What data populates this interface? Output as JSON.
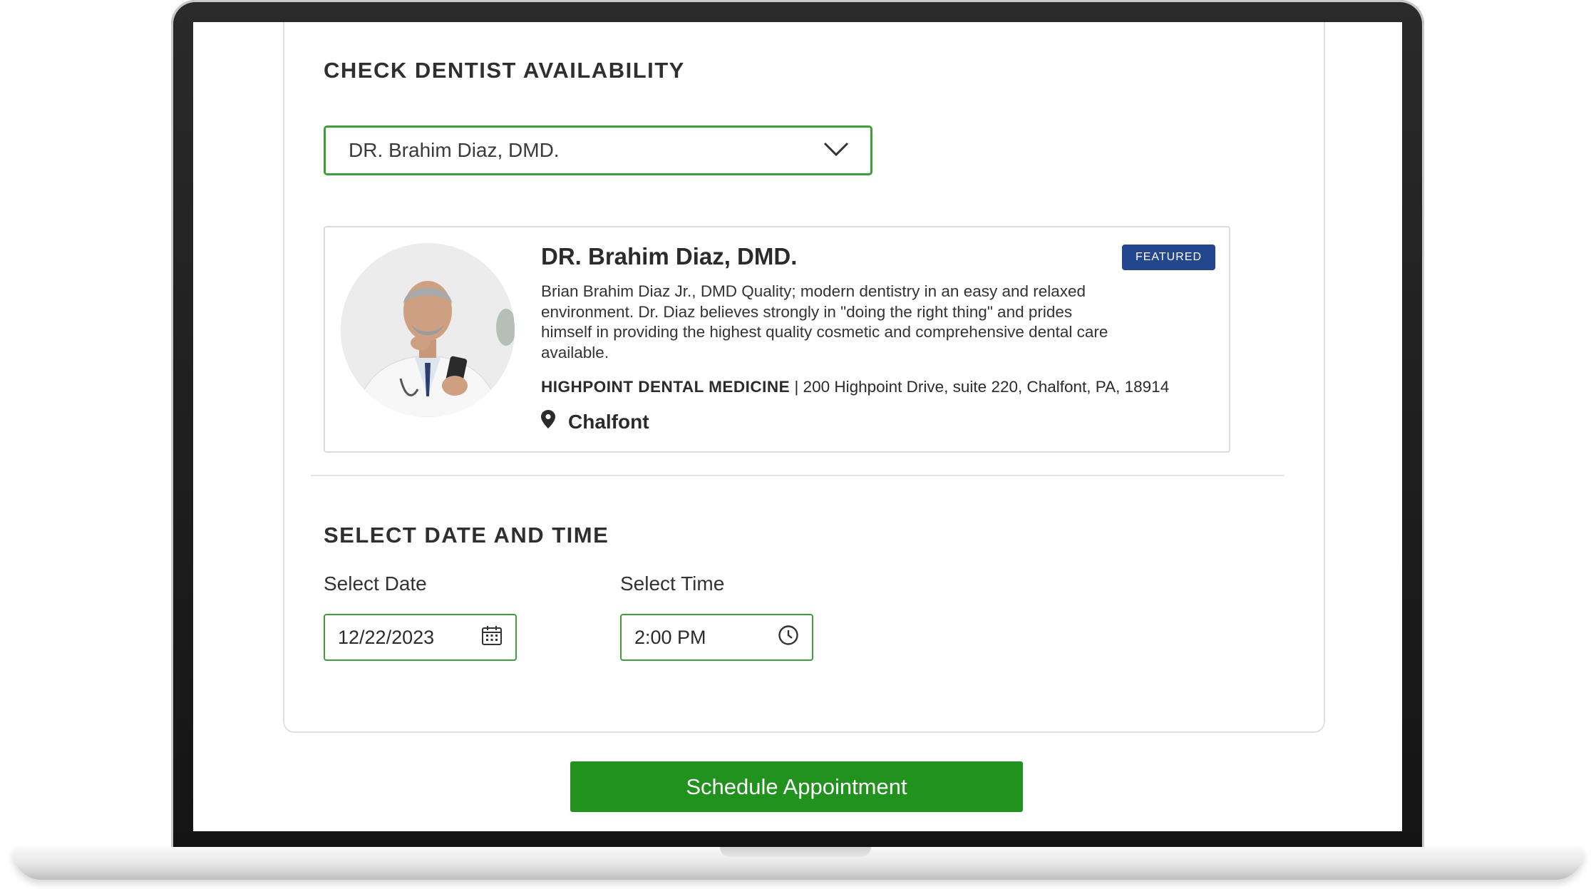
{
  "availability": {
    "title": "CHECK DENTIST AVAILABILITY",
    "selected_dentist": "DR. Brahim Diaz, DMD."
  },
  "dentist": {
    "name": "DR. Brahim Diaz, DMD.",
    "badge": "FEATURED",
    "bio": "Brian Brahim Diaz Jr., DMD Quality; modern dentistry in an easy and relaxed environment. Dr. Diaz believes strongly in \"doing the right thing\" and prides himself in providing the highest quality cosmetic and comprehensive dental care available.",
    "practice_name": "HIGHPOINT DENTAL MEDICINE",
    "address": "| 200 Highpoint Drive, suite 220, Chalfont, PA, 18914",
    "location": "Chalfont"
  },
  "datetime": {
    "title": "SELECT DATE AND TIME",
    "date_label": "Select Date",
    "date_value": "12/22/2023",
    "time_label": "Select Time",
    "time_value": "2:00 PM"
  },
  "actions": {
    "schedule_label": "Schedule Appointment"
  },
  "icons": {
    "dropdown": "chevron-down-icon",
    "date": "calendar-icon",
    "time": "clock-icon",
    "location": "map-pin-icon"
  },
  "colors": {
    "accent_green": "#22921f",
    "border_green": "#3f9e3a",
    "badge_blue": "#23478f"
  }
}
